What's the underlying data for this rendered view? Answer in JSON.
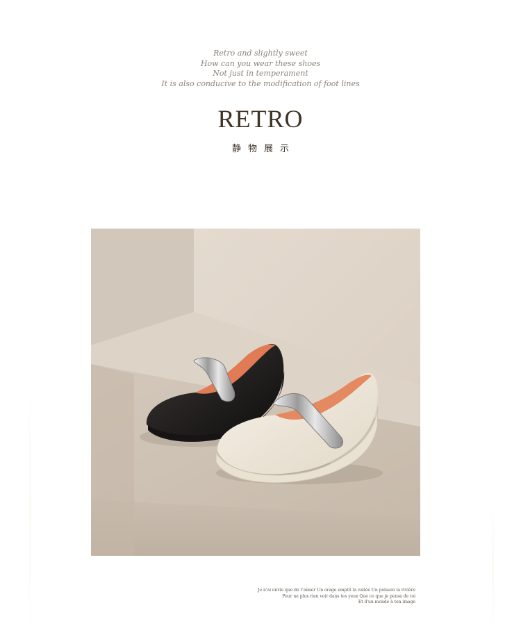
{
  "intro": {
    "lines": [
      "Retro and slightly sweet",
      "How can you wear these shoes",
      "Not just in temperament",
      "It is also conducive to the modification of foot lines"
    ]
  },
  "headline": "RETRO",
  "subtitle": "静物展示",
  "photo": {
    "subject": "black-and-cream-mary-jane-shoes-with-silver-strap"
  },
  "caption": {
    "lines": [
      "Je n'ai envie que de t'aimer Un orage emplit la vallée Un poisson la rivière",
      "Pour ne plus rien voir dans tes yeux Que ce que je pense de toi",
      "Et d'un monde à ton image"
    ]
  },
  "colors": {
    "headline": "#3e3326",
    "intro_text": "#8a8276",
    "backdrop_wall": "#e2d8cd",
    "backdrop_floor": "#cfc4b7"
  }
}
